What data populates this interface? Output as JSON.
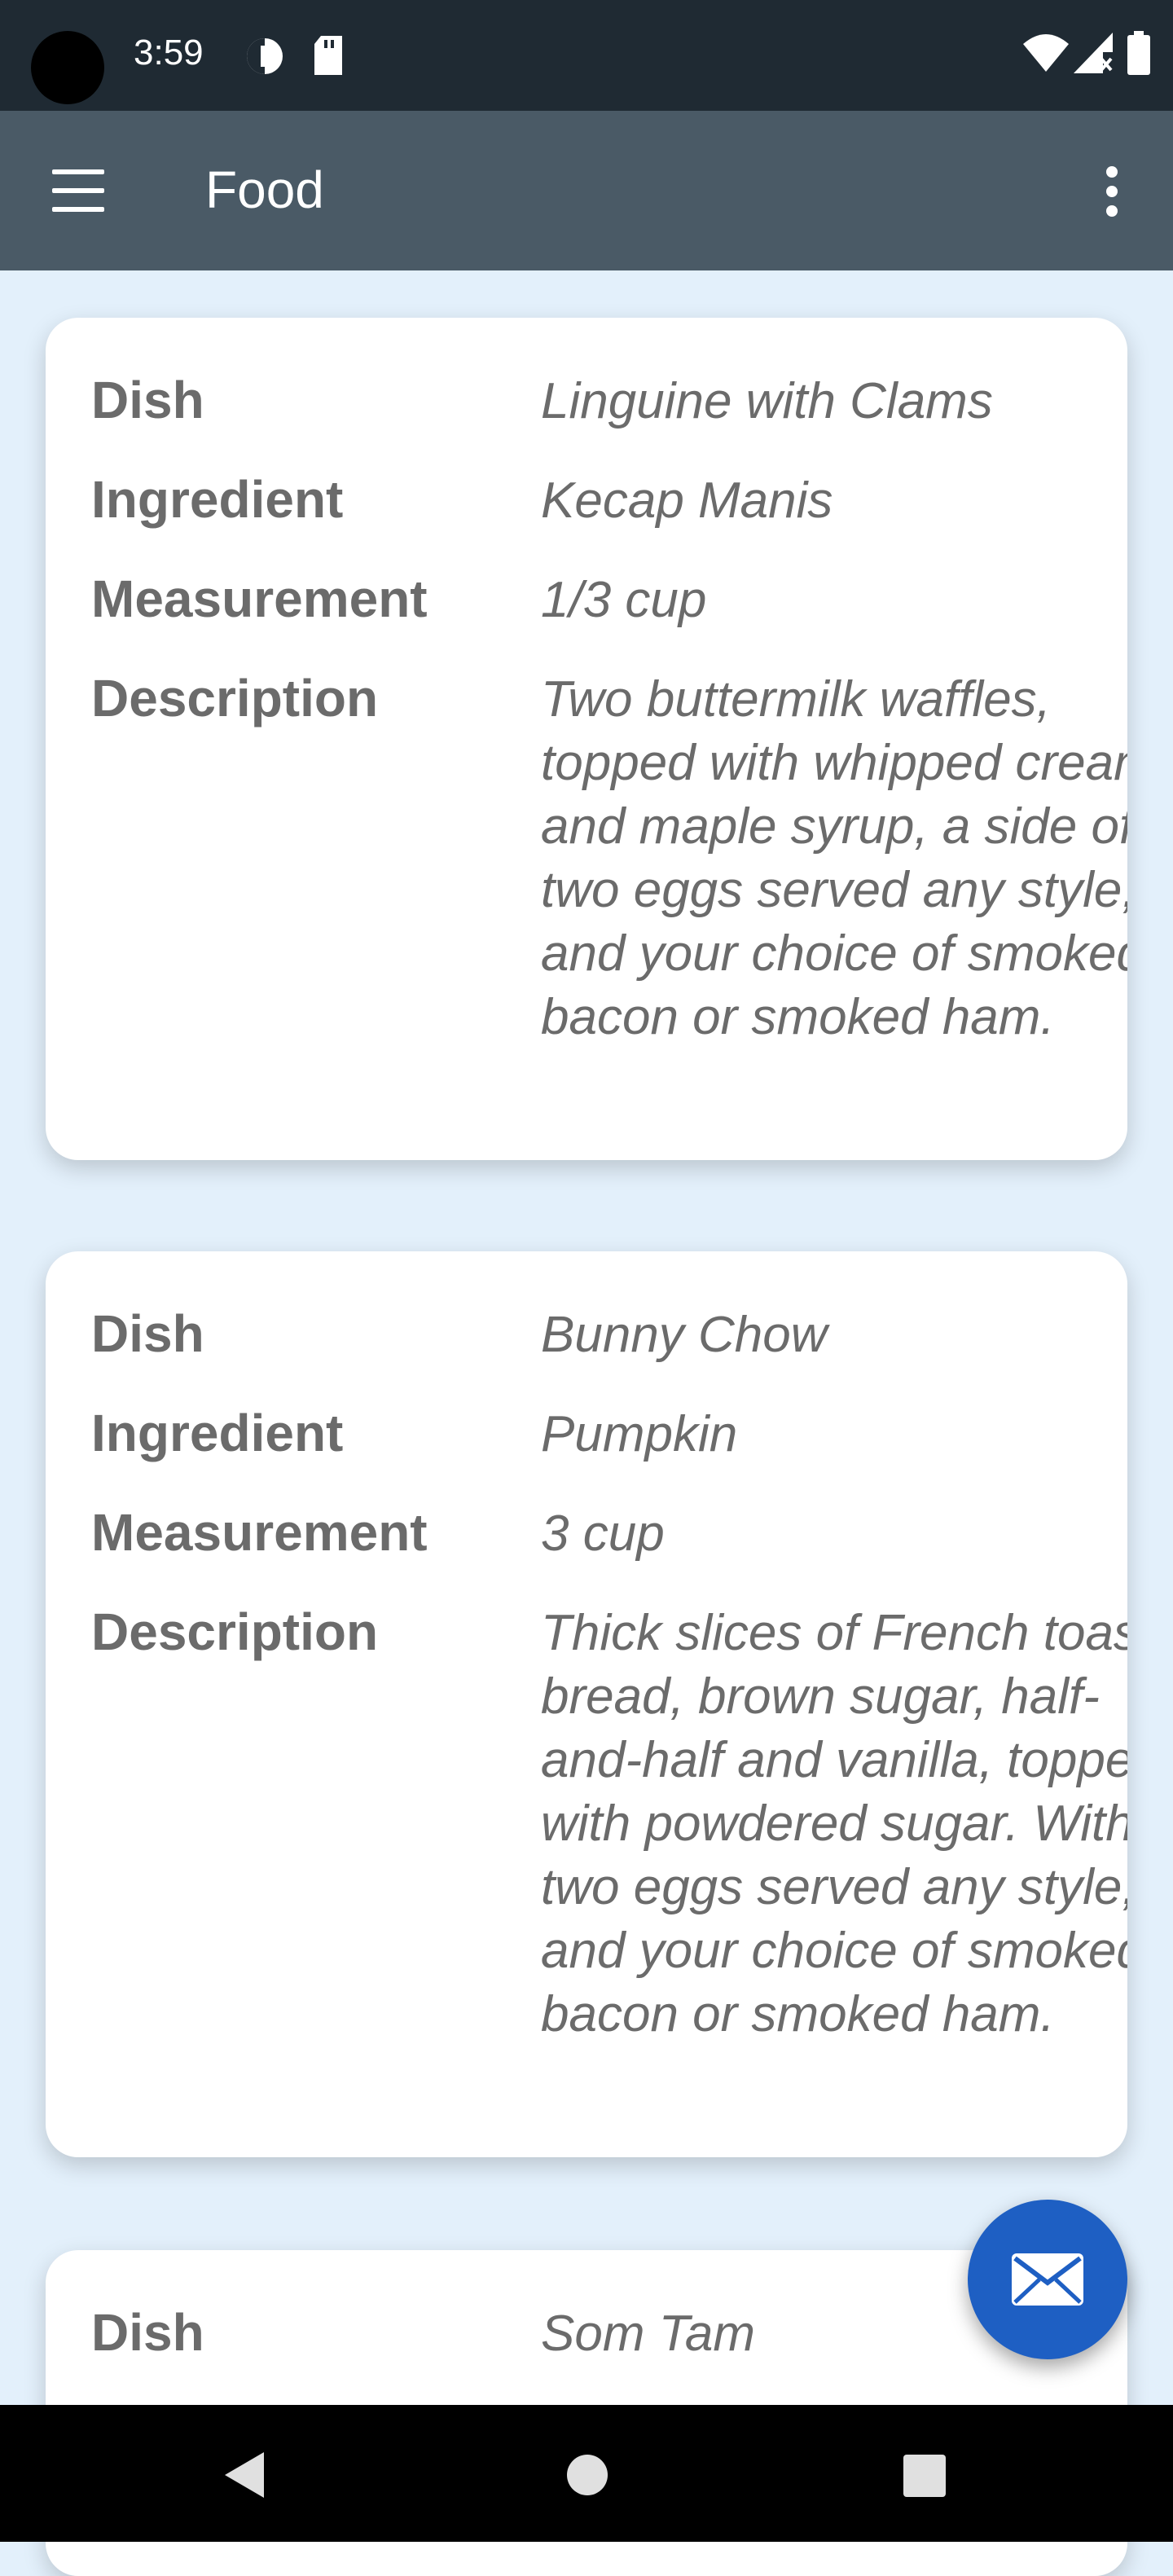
{
  "status_bar": {
    "time": "3:59",
    "icons": [
      "camera-cutout",
      "data-saver-icon",
      "sd-card-icon",
      "wifi-icon",
      "cell-signal-icon",
      "battery-icon"
    ]
  },
  "app_bar": {
    "title": "Food",
    "menu_icon": "hamburger-menu-icon",
    "overflow_icon": "more-vert-icon"
  },
  "labels": {
    "dish": "Dish",
    "ingredient": "Ingredient",
    "measurement": "Measurement",
    "description": "Description"
  },
  "cards": [
    {
      "dish": "Linguine with Clams",
      "ingredient": "Kecap Manis",
      "measurement": "1/3 cup",
      "description": "Two buttermilk waffles, topped with whipped cream and maple syrup, a side of two eggs served any style, and your choice of smoked bacon or smoked ham."
    },
    {
      "dish": "Bunny Chow",
      "ingredient": "Pumpkin",
      "measurement": "3 cup",
      "description": "Thick slices of French toast bread, brown sugar, half-and-half and vanilla, topped with powdered sugar. With two eggs served any style, and your choice of smoked bacon or smoked ham."
    },
    {
      "dish": "Som Tam"
    }
  ],
  "fab": {
    "icon": "email-icon"
  },
  "nav_bar": {
    "icons": [
      "back-icon",
      "home-icon",
      "recents-icon"
    ]
  },
  "colors": {
    "status_bar": "#1f2a33",
    "app_bar": "#4a5a66",
    "background": "#e3f0fb",
    "fab": "#1e5fc3",
    "text": "#6b6b6b"
  }
}
